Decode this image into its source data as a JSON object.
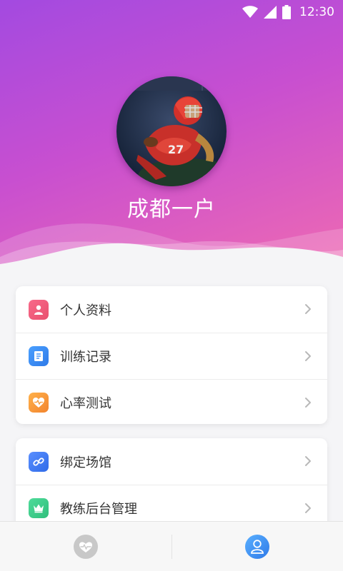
{
  "status_bar": {
    "time": "12:30",
    "icons": [
      "wifi-icon",
      "signal-icon",
      "battery-icon"
    ]
  },
  "profile": {
    "username": "成都一户",
    "avatar": "football-player-avatar"
  },
  "menu_group_1": [
    {
      "label": "个人资料",
      "icon": "person-icon",
      "color": "#f0607e"
    },
    {
      "label": "训练记录",
      "icon": "document-icon",
      "color": "#3a8ef5"
    },
    {
      "label": "心率测试",
      "icon": "heart-rate-icon",
      "color": "#f59a3a"
    }
  ],
  "menu_group_2": [
    {
      "label": "绑定场馆",
      "icon": "link-icon",
      "color": "#3f7ff5"
    },
    {
      "label": "教练后台管理",
      "icon": "crown-icon",
      "color": "#3ccf8e"
    }
  ],
  "tab_bar": {
    "tabs": [
      {
        "icon": "heart-pulse-icon",
        "active": false
      },
      {
        "icon": "user-icon",
        "active": true
      }
    ],
    "active_color": "#3d8ef5",
    "inactive_color": "#c8c8c8"
  }
}
